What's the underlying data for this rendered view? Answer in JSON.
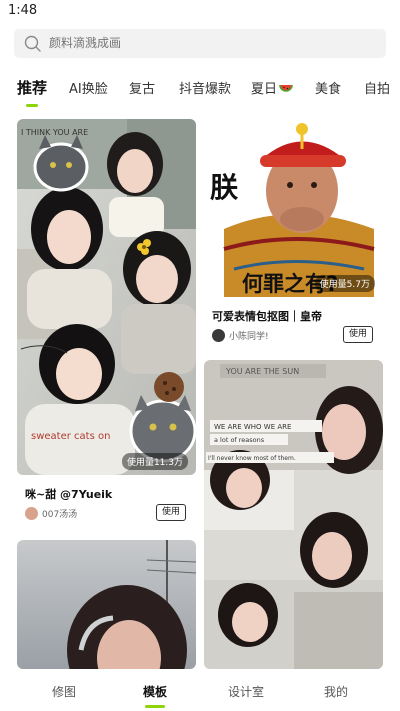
{
  "status_bar": {
    "time": "1:48"
  },
  "search": {
    "placeholder": "颜料滴溅成画"
  },
  "tabs": [
    {
      "label": "推荐",
      "active": true
    },
    {
      "label": "AI换脸"
    },
    {
      "label": "复古"
    },
    {
      "label": "抖音爆款"
    },
    {
      "label": "夏日"
    },
    {
      "label": "美食"
    },
    {
      "label": "自拍"
    }
  ],
  "cards": [
    {
      "title": "咪~甜 @7Yueik",
      "author": "007汤汤",
      "usage": "使用量11.3万",
      "button": "使用",
      "image_text": "I THINK YOU ARE",
      "image_text2": "sweater cats on"
    },
    {
      "title": "可爱表情包抠图｜皇帝",
      "author": "小陈同学!",
      "usage": "使用量5.7万",
      "button": "使用",
      "image_char": "朕",
      "image_caption": "何罪之有?"
    },
    {
      "image_texts": [
        "YOU ARE THE SUN",
        "WE ARE WHO WE ARE",
        "a lot of reasons",
        "I'll never know most of them."
      ]
    }
  ],
  "bottom_nav": [
    {
      "label": "修图"
    },
    {
      "label": "模板",
      "active": true
    },
    {
      "label": "设计室"
    },
    {
      "label": "我的"
    }
  ],
  "colors": {
    "accent": "#8fd30a",
    "search_bg": "#f2f2f2"
  }
}
